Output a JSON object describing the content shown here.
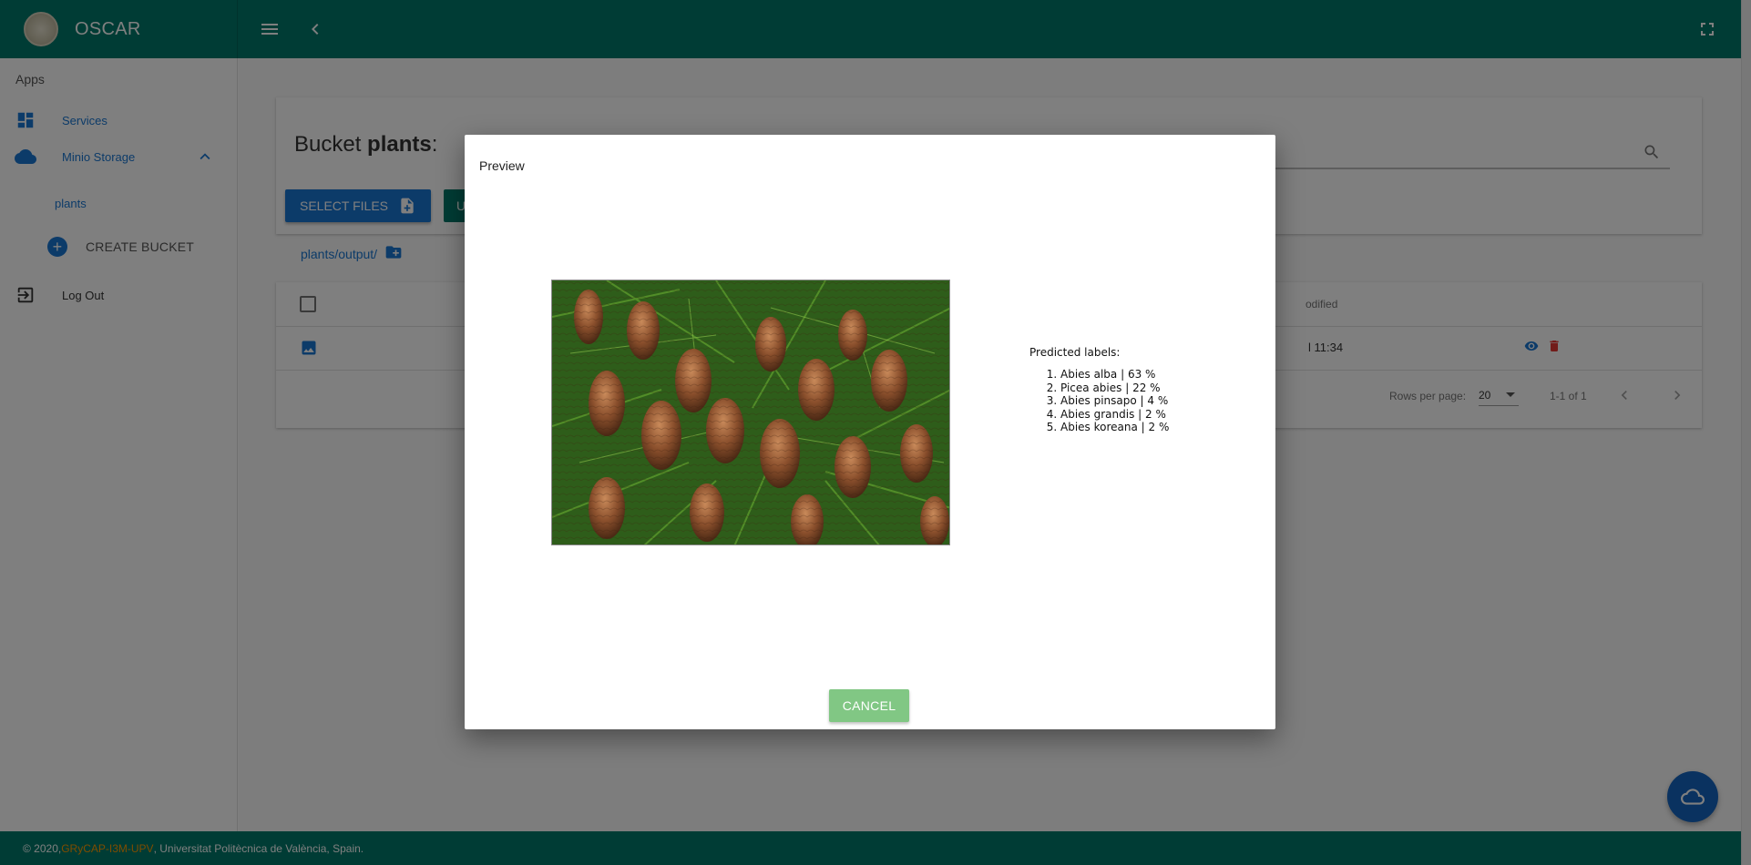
{
  "app": {
    "title": "OSCAR"
  },
  "sidebar": {
    "section_header": "Apps",
    "items": [
      {
        "label": "Services",
        "icon": "dashboard-icon"
      },
      {
        "label": "Minio Storage",
        "icon": "cloud-icon"
      }
    ],
    "buckets": [
      "plants"
    ],
    "create_bucket_label": "CREATE BUCKET",
    "logout_label": "Log Out"
  },
  "main": {
    "title_prefix": "Bucket ",
    "bucket_name": "plants",
    "title_suffix": ":",
    "select_files_label": "SELECT FILES",
    "upload_label": "U",
    "breadcrumb": "plants/output/",
    "table": {
      "modified_header": "odified",
      "row_date": "l 11:34"
    },
    "pagination": {
      "rows_per_page_label": "Rows per page:",
      "rows_per_page_value": "20",
      "range": "1-1 of 1"
    }
  },
  "dialog": {
    "title": "Preview",
    "predicted_header": "Predicted labels:",
    "predictions": [
      "Abies alba | 63 %",
      "Picea abies | 22 %",
      "Abies pinsapo | 4 %",
      "Abies grandis | 2 %",
      "Abies koreana | 2 %"
    ],
    "cancel_label": "CANCEL"
  },
  "footer": {
    "prefix": "© 2020, ",
    "org": "GRyCAP-I3M-UPV",
    "suffix": ", Universitat Politècnica de València, Spain."
  },
  "colors": {
    "primary_teal": "#00796b",
    "primary_blue": "#1976d2",
    "footer_org": "#ff9800",
    "cancel_green": "#81c784"
  }
}
